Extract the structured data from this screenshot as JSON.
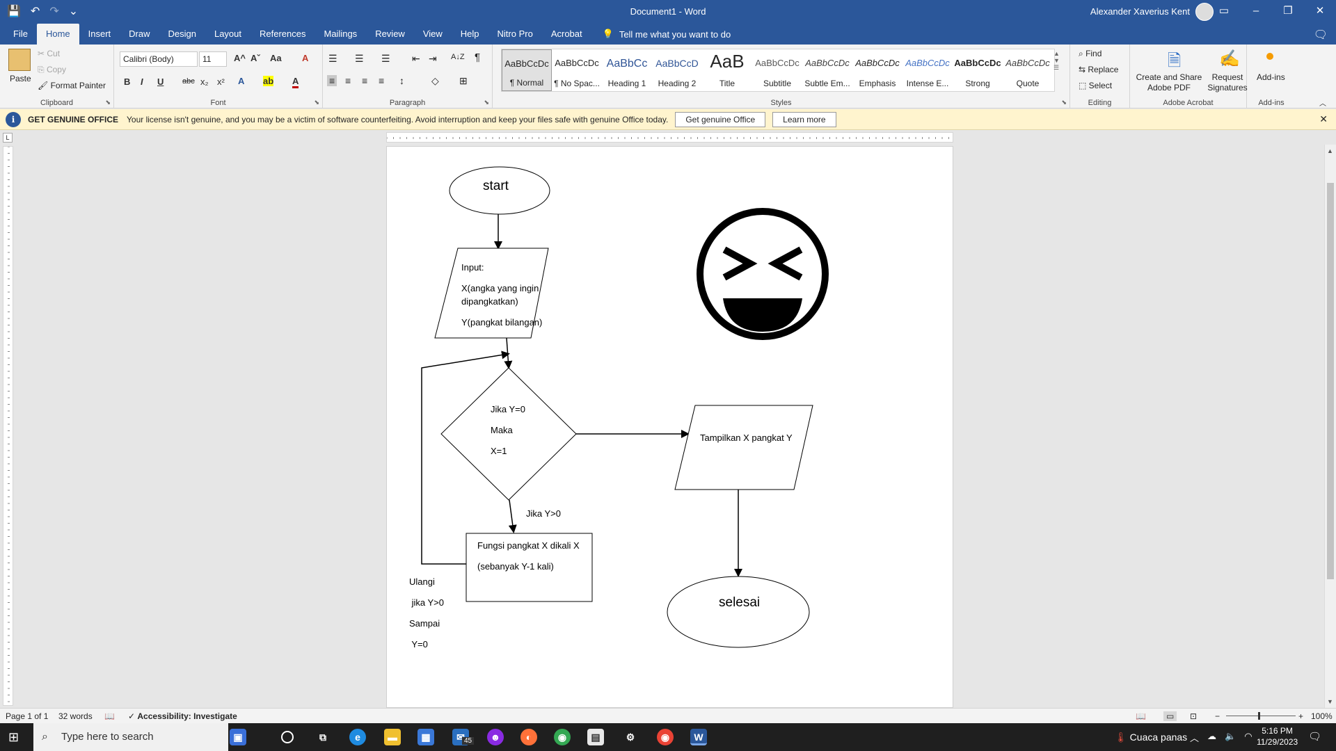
{
  "titlebar": {
    "doc_title": "Document1  -  Word",
    "user": "Alexander Xaverius Kent",
    "save_icon": "💾",
    "undo_icon": "↶",
    "redo_icon": "↷",
    "customize": "⌄",
    "ribbon_display": "▭",
    "minimize": "–",
    "restore": "❐",
    "close": "✕"
  },
  "tabs": [
    "File",
    "Home",
    "Insert",
    "Draw",
    "Design",
    "Layout",
    "References",
    "Mailings",
    "Review",
    "View",
    "Help",
    "Nitro Pro",
    "Acrobat"
  ],
  "active_tab": "Home",
  "tell_me": "Tell me what you want to do",
  "clipboard": {
    "paste": "Paste",
    "cut": "Cut",
    "copy": "Copy",
    "format_painter": "Format Painter",
    "label": "Clipboard"
  },
  "font": {
    "name": "Calibri (Body)",
    "size": "11",
    "grow": "A^",
    "shrink": "Aˇ",
    "case": "Aa",
    "clear": "A",
    "bold": "B",
    "italic": "I",
    "underline": "U",
    "strike": "abc",
    "sub": "x₂",
    "sup": "x²",
    "effects": "A",
    "highlight": "ab",
    "color": "A",
    "label": "Font"
  },
  "paragraph": {
    "label": "Paragraph",
    "show_marks": "¶",
    "sort": "A↓Z"
  },
  "styles": {
    "label": "Styles",
    "items": [
      {
        "preview": "AaBbCcDc",
        "name": "¶ Normal"
      },
      {
        "preview": "AaBbCcDc",
        "name": "¶ No Spac..."
      },
      {
        "preview": "AaBbCc",
        "name": "Heading 1"
      },
      {
        "preview": "AaBbCcD",
        "name": "Heading 2"
      },
      {
        "preview": "AaB",
        "name": "Title"
      },
      {
        "preview": "AaBbCcDc",
        "name": "Subtitle"
      },
      {
        "preview": "AaBbCcDc",
        "name": "Subtle Em..."
      },
      {
        "preview": "AaBbCcDc",
        "name": "Emphasis"
      },
      {
        "preview": "AaBbCcDc",
        "name": "Intense E..."
      },
      {
        "preview": "AaBbCcDc",
        "name": "Strong"
      },
      {
        "preview": "AaBbCcDc",
        "name": "Quote"
      }
    ]
  },
  "editing": {
    "find": "Find",
    "replace": "Replace",
    "select": "Select",
    "label": "Editing"
  },
  "acrobat": {
    "create": "Create and Share\nAdobe PDF",
    "request": "Request\nSignatures",
    "label": "Adobe Acrobat"
  },
  "addins": {
    "btn": "Add-ins",
    "label": "Add-ins"
  },
  "license": {
    "title": "GET GENUINE OFFICE",
    "message": "Your license isn't genuine, and you may be a victim of software counterfeiting. Avoid interruption and keep your files safe with genuine Office today.",
    "btn1": "Get genuine Office",
    "btn2": "Learn more",
    "close": "✕"
  },
  "ruler_corner": "L",
  "flowchart": {
    "start": "start",
    "input_title": "Input:",
    "input_x1": "X(angka yang ingin",
    "input_x2": "dipangkatkan)",
    "input_y": "Y(pangkat bilangan)",
    "cond1": "Jika Y=0",
    "cond2": "Maka",
    "cond3": "X=1",
    "branch": "Jika Y>0",
    "func1": "Fungsi pangkat X dikali X",
    "func2": "(sebanyak Y-1 kali)",
    "loop1": "Ulangi",
    "loop2": " jika Y>0",
    "loop3": "Sampai",
    "loop4": " Y=0",
    "output": "Tampilkan X pangkat Y",
    "end": "selesai"
  },
  "status": {
    "page": "Page 1 of 1",
    "words": "32 words",
    "accessibility": "Accessibility: Investigate",
    "zoom": "100%"
  },
  "taskbar": {
    "search": "Type here to search",
    "weather": "Cuaca panas",
    "time": "5:16 PM",
    "date": "11/29/2023",
    "mail_badge": "45"
  },
  "colors": {
    "word_blue": "#2b579a",
    "license_bg": "#fff4ce"
  }
}
